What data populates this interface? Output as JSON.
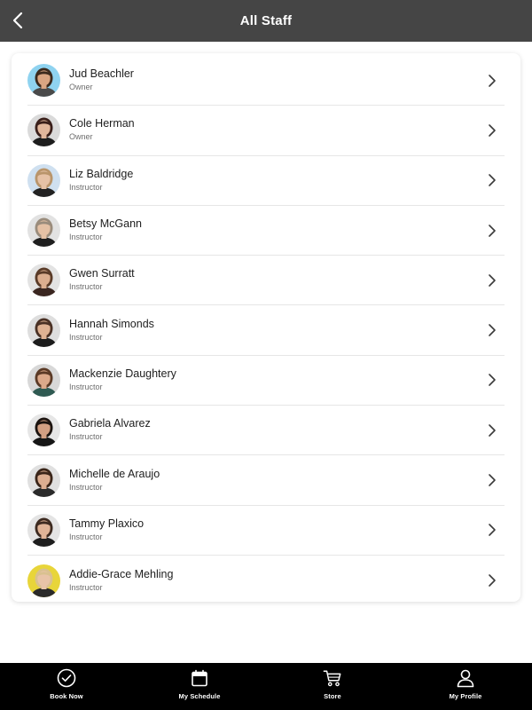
{
  "header": {
    "title": "All Staff",
    "back_icon": "chevron-left-icon"
  },
  "staff": [
    {
      "name": "Jud Beachler",
      "role": "Owner",
      "bg": "#8fd3f0",
      "hair": "#3b2a1e",
      "skin": "#d9a582",
      "shirt": "#4a4a4a"
    },
    {
      "name": "Cole Herman",
      "role": "Owner",
      "bg": "#dadada",
      "hair": "#3a1f1a",
      "skin": "#e2b79c",
      "shirt": "#1d1d1d"
    },
    {
      "name": "Liz Baldridge",
      "role": "Instructor",
      "bg": "#cfe0f0",
      "hair": "#b9956b",
      "skin": "#e6c2a6",
      "shirt": "#222222"
    },
    {
      "name": "Betsy McGann",
      "role": "Instructor",
      "bg": "#e2e2e2",
      "hair": "#9a8c7c",
      "skin": "#e5c1a5",
      "shirt": "#1f1f1f"
    },
    {
      "name": "Gwen Surratt",
      "role": "Instructor",
      "bg": "#e3e3e3",
      "hair": "#5a3b28",
      "skin": "#dcae8f",
      "shirt": "#3a2620"
    },
    {
      "name": "Hannah Simonds",
      "role": "Instructor",
      "bg": "#dedede",
      "hair": "#4a3125",
      "skin": "#dfb293",
      "shirt": "#1c1c1c"
    },
    {
      "name": "Mackenzie Daughtery",
      "role": "Instructor",
      "bg": "#d8d8d8",
      "hair": "#5b3a26",
      "skin": "#dca98a",
      "shirt": "#2f5a52"
    },
    {
      "name": "Gabriela Alvarez",
      "role": "Instructor",
      "bg": "#e6e6e6",
      "hair": "#1c1410",
      "skin": "#d3a083",
      "shirt": "#161616"
    },
    {
      "name": "Michelle de Araujo",
      "role": "Instructor",
      "bg": "#e0e0e0",
      "hair": "#3a2519",
      "skin": "#dcae91",
      "shirt": "#2a2a2a"
    },
    {
      "name": "Tammy Plaxico",
      "role": "Instructor",
      "bg": "#e4e4e4",
      "hair": "#3d2a20",
      "skin": "#e0b497",
      "shirt": "#1e1e1e"
    },
    {
      "name": "Addie-Grace Mehling",
      "role": "Instructor",
      "bg": "#e8d53a",
      "hair": "#d9c18f",
      "skin": "#e8c4a8",
      "shirt": "#2a2a2a"
    }
  ],
  "tabs": [
    {
      "label": "Book Now",
      "icon": "check-circle-icon"
    },
    {
      "label": "My Schedule",
      "icon": "calendar-icon"
    },
    {
      "label": "Store",
      "icon": "cart-icon"
    },
    {
      "label": "My Profile",
      "icon": "person-icon"
    }
  ],
  "colors": {
    "header_bg": "#454545",
    "tabbar_bg": "#000000",
    "divider": "#e6e6e6"
  }
}
